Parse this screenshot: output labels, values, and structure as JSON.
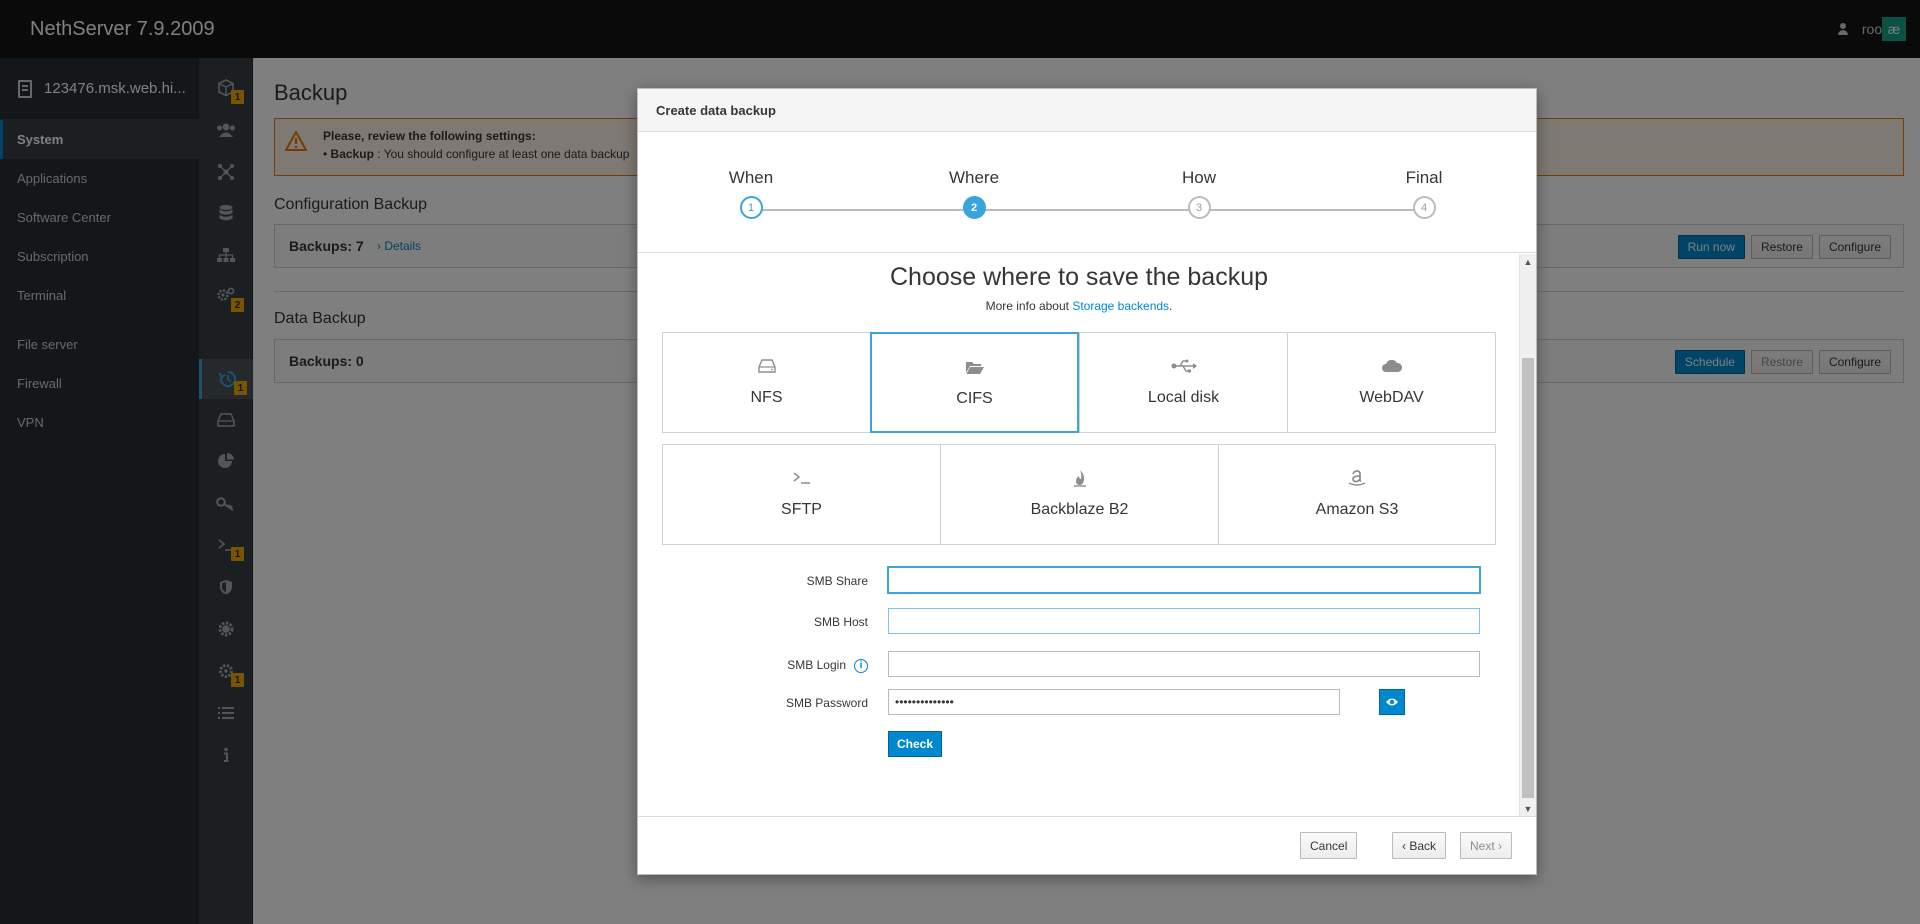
{
  "app": {
    "title": "NethServer 7.9.2009",
    "user": "root",
    "user_badge": "æ"
  },
  "sidebar": {
    "host": "123476.msk.web.hi...",
    "items": [
      {
        "label": "System",
        "active": true
      },
      {
        "label": "Applications"
      },
      {
        "label": "Software Center"
      },
      {
        "label": "Subscription"
      },
      {
        "label": "Terminal"
      },
      {
        "label": "File server"
      },
      {
        "label": "Firewall"
      },
      {
        "label": "VPN"
      }
    ]
  },
  "rail": {
    "items": [
      {
        "icon": "box-icon",
        "badge": "1"
      },
      {
        "icon": "users-icon"
      },
      {
        "icon": "network-icon"
      },
      {
        "icon": "database-icon"
      },
      {
        "icon": "sitemap-icon"
      },
      {
        "icon": "settings-icon",
        "badge": "2"
      },
      {
        "icon": "backup-icon",
        "badge": "1",
        "active": true
      },
      {
        "icon": "disk-icon"
      },
      {
        "icon": "pie-chart-icon"
      },
      {
        "icon": "key-icon"
      },
      {
        "icon": "terminal-icon",
        "badge": "1"
      },
      {
        "icon": "shield-icon"
      },
      {
        "icon": "cog-icon"
      },
      {
        "icon": "gear-icon",
        "badge": "1"
      },
      {
        "icon": "list-icon"
      },
      {
        "icon": "info-icon"
      }
    ]
  },
  "page": {
    "title": "Backup",
    "alert": {
      "title": "Please, review the following settings:",
      "item_label": "Backup",
      "item_text": " : You should configure at least one data backup"
    },
    "config_backup": {
      "title": "Configuration Backup",
      "count": "Backups: 7",
      "details": "› Details",
      "buttons": {
        "run": "Run now",
        "restore": "Restore",
        "configure": "Configure"
      }
    },
    "data_backup": {
      "title": "Data Backup",
      "count": "Backups: 0",
      "buttons": {
        "schedule": "Schedule",
        "restore": "Restore",
        "configure": "Configure"
      }
    }
  },
  "modal": {
    "title": "Create data backup",
    "steps": [
      {
        "label": "When",
        "num": "1",
        "state": "done"
      },
      {
        "label": "Where",
        "num": "2",
        "state": "current"
      },
      {
        "label": "How",
        "num": "3",
        "state": "todo"
      },
      {
        "label": "Final",
        "num": "4",
        "state": "todo"
      }
    ],
    "heading": "Choose where to save the backup",
    "more_info_prefix": "More info about ",
    "more_info_link": "Storage backends",
    "more_info_suffix": ".",
    "backends": [
      {
        "label": "NFS",
        "icon": "hdd-icon"
      },
      {
        "label": "CIFS",
        "icon": "folder-open-icon",
        "selected": true
      },
      {
        "label": "Local disk",
        "icon": "usb-icon"
      },
      {
        "label": "WebDAV",
        "icon": "cloud-icon"
      },
      {
        "label": "SFTP",
        "icon": "terminal-icon"
      },
      {
        "label": "Backblaze B2",
        "icon": "fire-icon"
      },
      {
        "label": "Amazon S3",
        "icon": "amazon-icon"
      }
    ],
    "form": {
      "smb_share": {
        "label": "SMB Share",
        "value": ""
      },
      "smb_host": {
        "label": "SMB Host",
        "value": ""
      },
      "smb_login": {
        "label": "SMB Login",
        "value": ""
      },
      "smb_password": {
        "label": "SMB Password",
        "value": "••••••••••••••"
      },
      "check": "Check"
    },
    "footer": {
      "cancel": "Cancel",
      "back": "‹  Back",
      "next": "Next  ›"
    }
  },
  "colors": {
    "accent": "#0088ce",
    "step": "#39a5dc",
    "warning": "#ec7a08",
    "badge": "#f0ab00"
  }
}
